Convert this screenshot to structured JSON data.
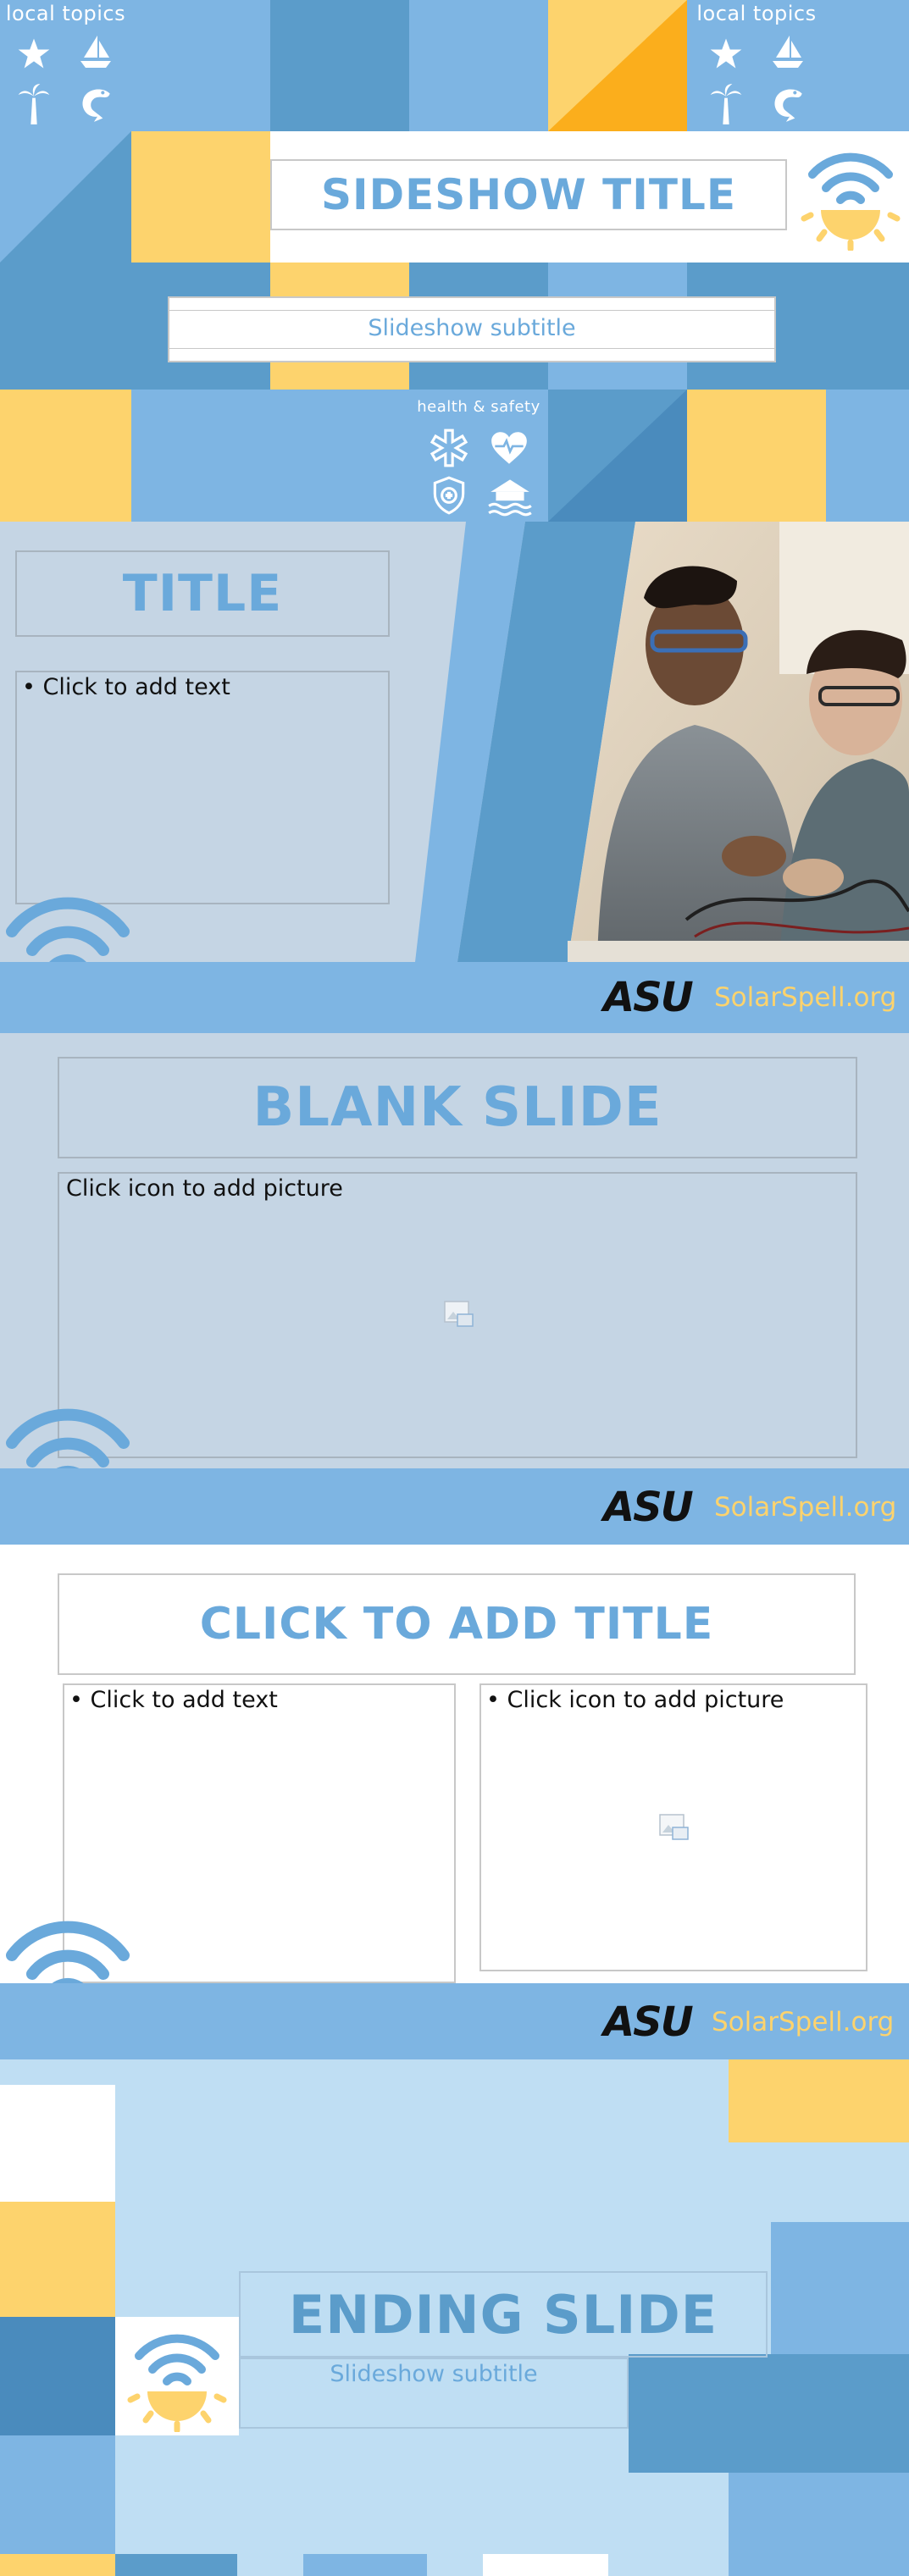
{
  "title_slide": {
    "title": "SIDESHOW TITLE",
    "subtitle": "Slideshow subtitle",
    "local_topics_label": "local topics",
    "health_safety_label": "health & safety",
    "local_icons": [
      "star-icon",
      "sailboat-icon",
      "palm-tree-icon",
      "shrimp-icon"
    ],
    "health_icons": [
      "medical-star-icon",
      "heart-rate-icon",
      "shield-icon",
      "flood-house-icon"
    ]
  },
  "content_slide": {
    "title": "TITLE",
    "body_bullet": "• Click to add text"
  },
  "blank_slide": {
    "title": "BLANK SLIDE",
    "picture_prompt": "Click icon to add picture"
  },
  "two_column_slide": {
    "title": "CLICK TO ADD TITLE",
    "left_bullet": "• Click to add text",
    "right_bullet": "• Click icon to add picture"
  },
  "ending_slide": {
    "title": "ENDING SLIDE",
    "subtitle": "Slideshow subtitle"
  },
  "footer": {
    "logo_text": "ASU",
    "site": "SolarSpell.org"
  },
  "colors": {
    "light_blue": "#7eb5e3",
    "mid_blue": "#5b9cca",
    "dark_blue": "#4a8bbd",
    "yellow": "#fdd36d",
    "gold": "#fbae1c",
    "slide_gray_blue": "#c5d5e4",
    "pale_blue": "#bfdef3",
    "title_blue": "#6aa9db"
  }
}
